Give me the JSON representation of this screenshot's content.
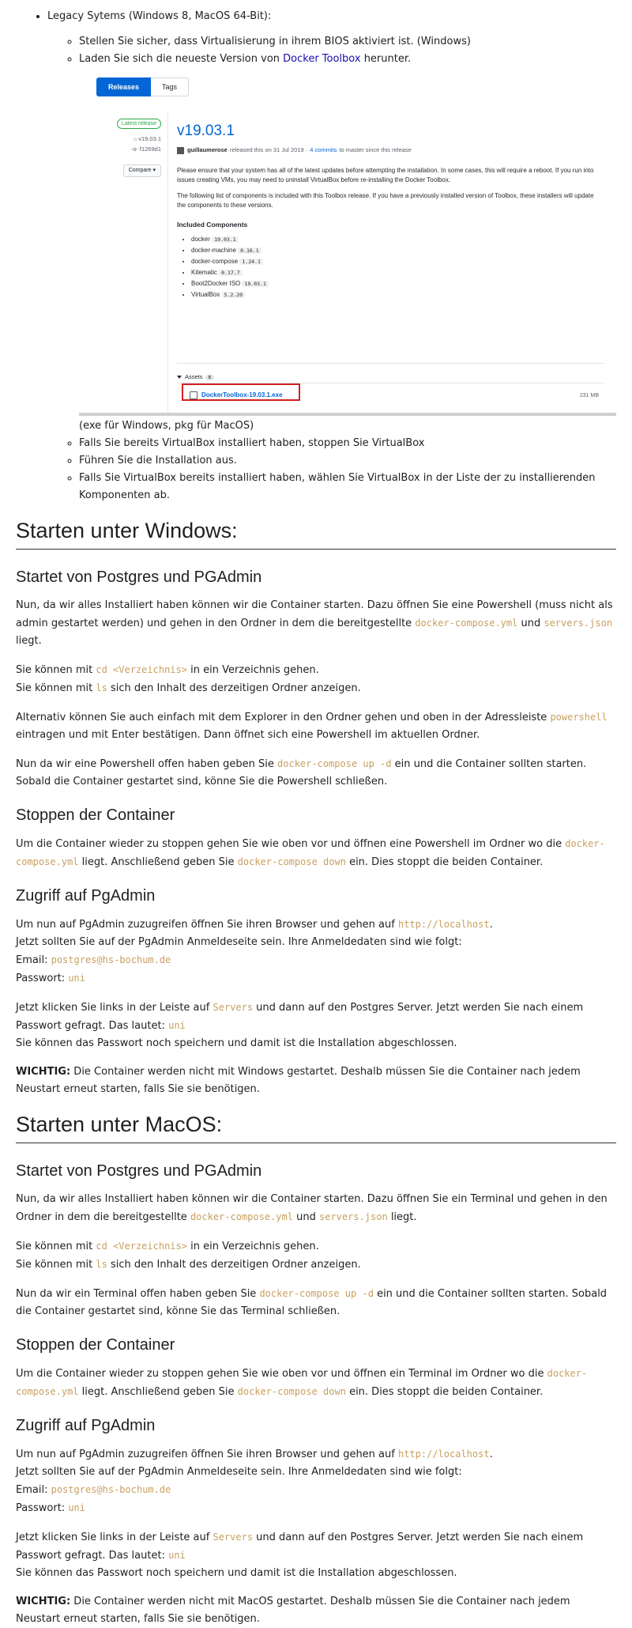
{
  "legacy": {
    "title": "Legacy Sytems (Windows 8, MacOS 64-Bit):",
    "item1": "Stellen Sie sicher, dass Virtualisierung in ihrem BIOS aktiviert ist. (Windows)",
    "item2_pre": "Laden Sie sich die neueste Version von ",
    "item2_link": "Docker Toolbox",
    "item2_post": " herunter.",
    "caption": "(exe für Windows, pkg für MacOS)",
    "item3": "Falls Sie bereits VirtualBox installiert haben, stoppen Sie VirtualBox",
    "item4": "Führen Sie die Installation aus.",
    "item5": "Falls Sie VirtualBox bereits installiert haben, wählen Sie VirtualBox in der Liste der zu installierenden Komponenten ab."
  },
  "release": {
    "tab_releases": "Releases",
    "tab_tags": "Tags",
    "latest_badge": "Latest release",
    "tag": "v19.03.1",
    "commit": "f1269d1",
    "compare": "Compare",
    "version": "v19.03.1",
    "author": "guillaumerose",
    "meta_pre": "released this on 31 Jul 2019 ·",
    "meta_link": "4 commits",
    "meta_post": "to master since this release",
    "para1": "Please ensure that your system has all of the latest updates before attempting the installation. In some cases, this will require a reboot. If you run into issues creating VMs, you may need to uninstall VirtualBox before re-installing the Docker Toolbox.",
    "para2": "The following list of components is included with this Toolbox release. If you have a previously installed version of Toolbox, these installers will update the components to these versions.",
    "included_title": "Included Components",
    "components": [
      {
        "name": "docker",
        "version": "19.03.1"
      },
      {
        "name": "docker-machine",
        "version": "0.16.1"
      },
      {
        "name": "docker-compose",
        "version": "1.24.1"
      },
      {
        "name": "Kitematic",
        "version": "0.17.7"
      },
      {
        "name": "Boot2Docker ISO",
        "version": "19.03.1"
      },
      {
        "name": "VirtualBox",
        "version": "5.2.20"
      }
    ],
    "assets_label": "Assets",
    "assets_count": "6",
    "asset_name": "DockerToolbox-19.03.1.exe",
    "asset_size": "231 MB"
  },
  "win": {
    "heading": "Starten unter Windows:",
    "start_heading": "Startet von Postgres und PGAdmin",
    "p1_a": "Nun, da wir alles Installiert haben können wir die Container starten. Dazu öffnen Sie eine Powershell (muss nicht als admin gestartet werden) und gehen in den Ordner in dem die bereitgestellte ",
    "p1_code1": "docker-compose.yml",
    "p1_b": " und ",
    "p1_code2": "servers.json",
    "p1_c": " liegt.",
    "cd_a": "Sie können mit ",
    "cd_code": "cd <Verzeichnis>",
    "cd_b": " in ein Verzeichnis gehen.",
    "ls_a": "Sie können mit ",
    "ls_code": "ls",
    "ls_b": " sich den Inhalt des derzeitigen Ordner anzeigen.",
    "alt_a": "Alternativ können Sie auch einfach mit dem Explorer in den Ordner gehen und oben in der Adressleiste ",
    "alt_code": "powershell",
    "alt_b": " eintragen und mit Enter bestätigen. Dann öffnet sich eine Powershell im aktuellen Ordner.",
    "up_a": "Nun da wir eine Powershell offen haben geben Sie ",
    "up_code": "docker-compose up -d",
    "up_b": " ein und die Container sollten starten. Sobald die Container gestartet sind, könne Sie die Powershell schließen.",
    "stop_heading": "Stoppen der Container",
    "stop_a": "Um die Container wieder zu stoppen gehen Sie wie oben vor und öffnen eine Powershell im Ordner wo die ",
    "stop_code1": "docker-compose.yml",
    "stop_b": " liegt. Anschließend geben Sie ",
    "stop_code2": "docker-compose down",
    "stop_c": " ein. Dies stoppt die beiden Container.",
    "access_heading": "Zugriff auf PgAdmin",
    "acc_a": "Um nun auf PgAdmin zuzugreifen öffnen Sie ihren Browser und gehen auf ",
    "acc_code": "http://localhost",
    "acc_b": ".",
    "acc_line2": "Jetzt sollten Sie auf der PgAdmin Anmeldeseite sein. Ihre Anmeldedaten sind wie folgt:",
    "email_label": "Email: ",
    "email_value": "postgres@hs-bochum.de",
    "pw_label": "Passwort: ",
    "pw_value": "uni",
    "srv_a": "Jetzt klicken Sie links in der Leiste auf ",
    "srv_code": "Servers",
    "srv_b": " und dann auf den Postgres Server. Jetzt werden Sie nach einem Passwort gefragt. Das lautet: ",
    "srv_code2": "uni",
    "srv_line2": "Sie können das Passwort noch speichern und damit ist die Installation abgeschlossen.",
    "warn_label": "WICHTIG:",
    "warn_text": " Die Container werden nicht mit Windows gestartet. Deshalb müssen Sie die Container nach jedem Neustart erneut starten, falls Sie sie benötigen."
  },
  "mac": {
    "heading": "Starten unter MacOS:",
    "start_heading": "Startet von Postgres und PGAdmin",
    "p1_a": "Nun, da wir alles Installiert haben können wir die Container starten. Dazu öffnen Sie ein Terminal und gehen in den Ordner in dem die bereitgestellte ",
    "p1_code1": "docker-compose.yml",
    "p1_b": " und ",
    "p1_code2": "servers.json",
    "p1_c": " liegt.",
    "cd_a": "Sie können mit ",
    "cd_code": "cd <Verzeichnis>",
    "cd_b": " in ein Verzeichnis gehen.",
    "ls_a": "Sie können mit ",
    "ls_code": "ls",
    "ls_b": " sich den Inhalt des derzeitigen Ordner anzeigen.",
    "up_a": "Nun da wir ein Terminal offen haben geben Sie ",
    "up_code": "docker-compose up -d",
    "up_b": " ein und die Container sollten starten. Sobald die Container gestartet sind, könne Sie das Terminal schließen.",
    "stop_heading": "Stoppen der Container",
    "stop_a": "Um die Container wieder zu stoppen gehen Sie wie oben vor und öffnen ein Terminal im Ordner wo die ",
    "stop_code1": "docker-compose.yml",
    "stop_b": " liegt. Anschließend geben Sie ",
    "stop_code2": "docker-compose down",
    "stop_c": " ein. Dies stoppt die beiden Container.",
    "access_heading": "Zugriff auf PgAdmin",
    "acc_a": "Um nun auf PgAdmin zuzugreifen öffnen Sie ihren Browser und gehen auf ",
    "acc_code": "http://localhost",
    "acc_b": ".",
    "acc_line2": "Jetzt sollten Sie auf der PgAdmin Anmeldeseite sein. Ihre Anmeldedaten sind wie folgt:",
    "email_label": "Email: ",
    "email_value": "postgres@hs-bochum.de",
    "pw_label": "Passwort: ",
    "pw_value": "uni",
    "srv_a": "Jetzt klicken Sie links in der Leiste auf ",
    "srv_code": "Servers",
    "srv_b": " und dann auf den Postgres Server. Jetzt werden Sie nach einem Passwort gefragt. Das lautet: ",
    "srv_code2": "uni",
    "srv_line2": "Sie können das Passwort noch speichern und damit ist die Installation abgeschlossen.",
    "warn_label": "WICHTIG:",
    "warn_text": " Die Container werden nicht mit MacOS gestartet. Deshalb müssen Sie die Container nach jedem Neustart erneut starten, falls Sie sie benötigen."
  }
}
